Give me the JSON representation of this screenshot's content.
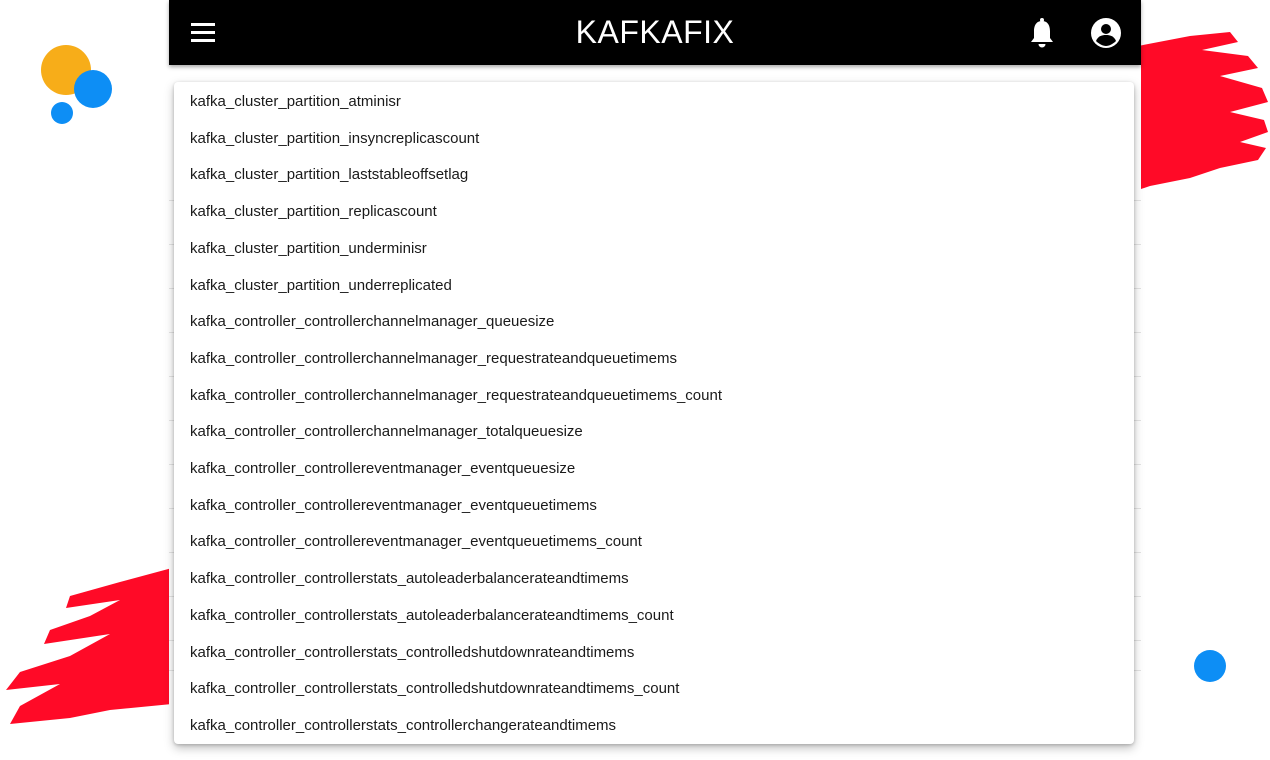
{
  "header": {
    "title": "KAFKAFIX",
    "menu_icon": "hamburger-menu-icon",
    "notification_icon": "bell-icon",
    "account_icon": "account-circle-icon"
  },
  "colors": {
    "appbar": "#000000",
    "accent_red": "#ff0a27",
    "accent_blue": "#0d8ef5",
    "accent_yellow": "#f7ad19"
  },
  "dropdown": {
    "options": [
      "kafka_cluster_partition_atminisr",
      "kafka_cluster_partition_insyncreplicascount",
      "kafka_cluster_partition_laststableoffsetlag",
      "kafka_cluster_partition_replicascount",
      "kafka_cluster_partition_underminisr",
      "kafka_cluster_partition_underreplicated",
      "kafka_controller_controllerchannelmanager_queuesize",
      "kafka_controller_controllerchannelmanager_requestrateandqueuetimems",
      "kafka_controller_controllerchannelmanager_requestrateandqueuetimems_count",
      "kafka_controller_controllerchannelmanager_totalqueuesize",
      "kafka_controller_controllereventmanager_eventqueuesize",
      "kafka_controller_controllereventmanager_eventqueuetimems",
      "kafka_controller_controllereventmanager_eventqueuetimems_count",
      "kafka_controller_controllerstats_autoleaderbalancerateandtimems",
      "kafka_controller_controllerstats_autoleaderbalancerateandtimems_count",
      "kafka_controller_controllerstats_controlledshutdownrateandtimems",
      "kafka_controller_controllerstats_controlledshutdownrateandtimems_count",
      "kafka_controller_controllerstats_controllerchangerateandtimems"
    ]
  }
}
